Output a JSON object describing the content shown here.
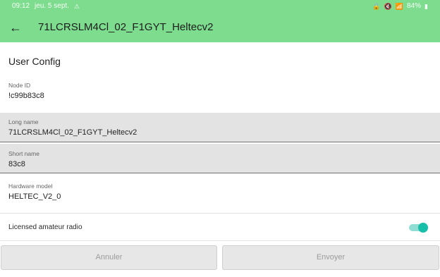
{
  "status_bar": {
    "time": "09:12",
    "date": "jeu. 5 sept.",
    "left_icons": "⚠",
    "battery": "84%"
  },
  "appbar": {
    "title": "71LCRSLM4Cl_02_F1GYT_Heltecv2",
    "back_icon": "←"
  },
  "section": {
    "title": "User Config"
  },
  "fields": {
    "node_id": {
      "label": "Node ID",
      "value": "!c99b83c8"
    },
    "long_name": {
      "label": "Long name",
      "value": "71LCRSLM4Cl_02_F1GYT_Heltecv2"
    },
    "short_name": {
      "label": "Short name",
      "value": "83c8"
    },
    "hardware_model": {
      "label": "Hardware model",
      "value": "HELTEC_V2_0"
    }
  },
  "licensed": {
    "label": "Licensed amateur radio",
    "enabled": true
  },
  "buttons": {
    "cancel": "Annuler",
    "send": "Envoyer"
  },
  "colors": {
    "appbar": "#7ddc8e",
    "toggle_accent": "#16bfa9",
    "field_fill": "#e3e3e3"
  },
  "icons": {
    "back": "arrow-left-icon",
    "toggle": "toggle-switch-icon"
  }
}
